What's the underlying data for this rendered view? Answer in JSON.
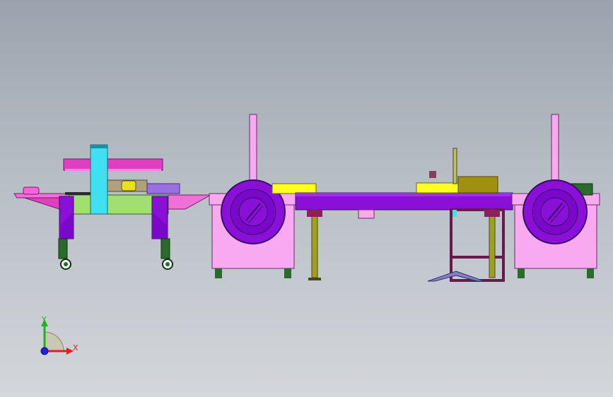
{
  "view": {
    "type": "cad-3d-viewport",
    "projection": "front",
    "background": [
      "#9aa3ad",
      "#d3d6da"
    ]
  },
  "triad": {
    "x_label": "X",
    "y_label": "Y",
    "x_color": "#e02020",
    "y_color": "#20b020",
    "z_color": "#2020e0"
  },
  "palette": {
    "pink": "#f9a9ef",
    "magenta": "#e040c0",
    "purple": "#8a10d8",
    "dark_purple": "#5a0a9a",
    "violet": "#8060e0",
    "yellow": "#ffff20",
    "cyan": "#40e0f0",
    "green": "#a0e070",
    "olive": "#a0a020",
    "dark_green": "#2a6a2a",
    "maroon": "#8a2060"
  }
}
